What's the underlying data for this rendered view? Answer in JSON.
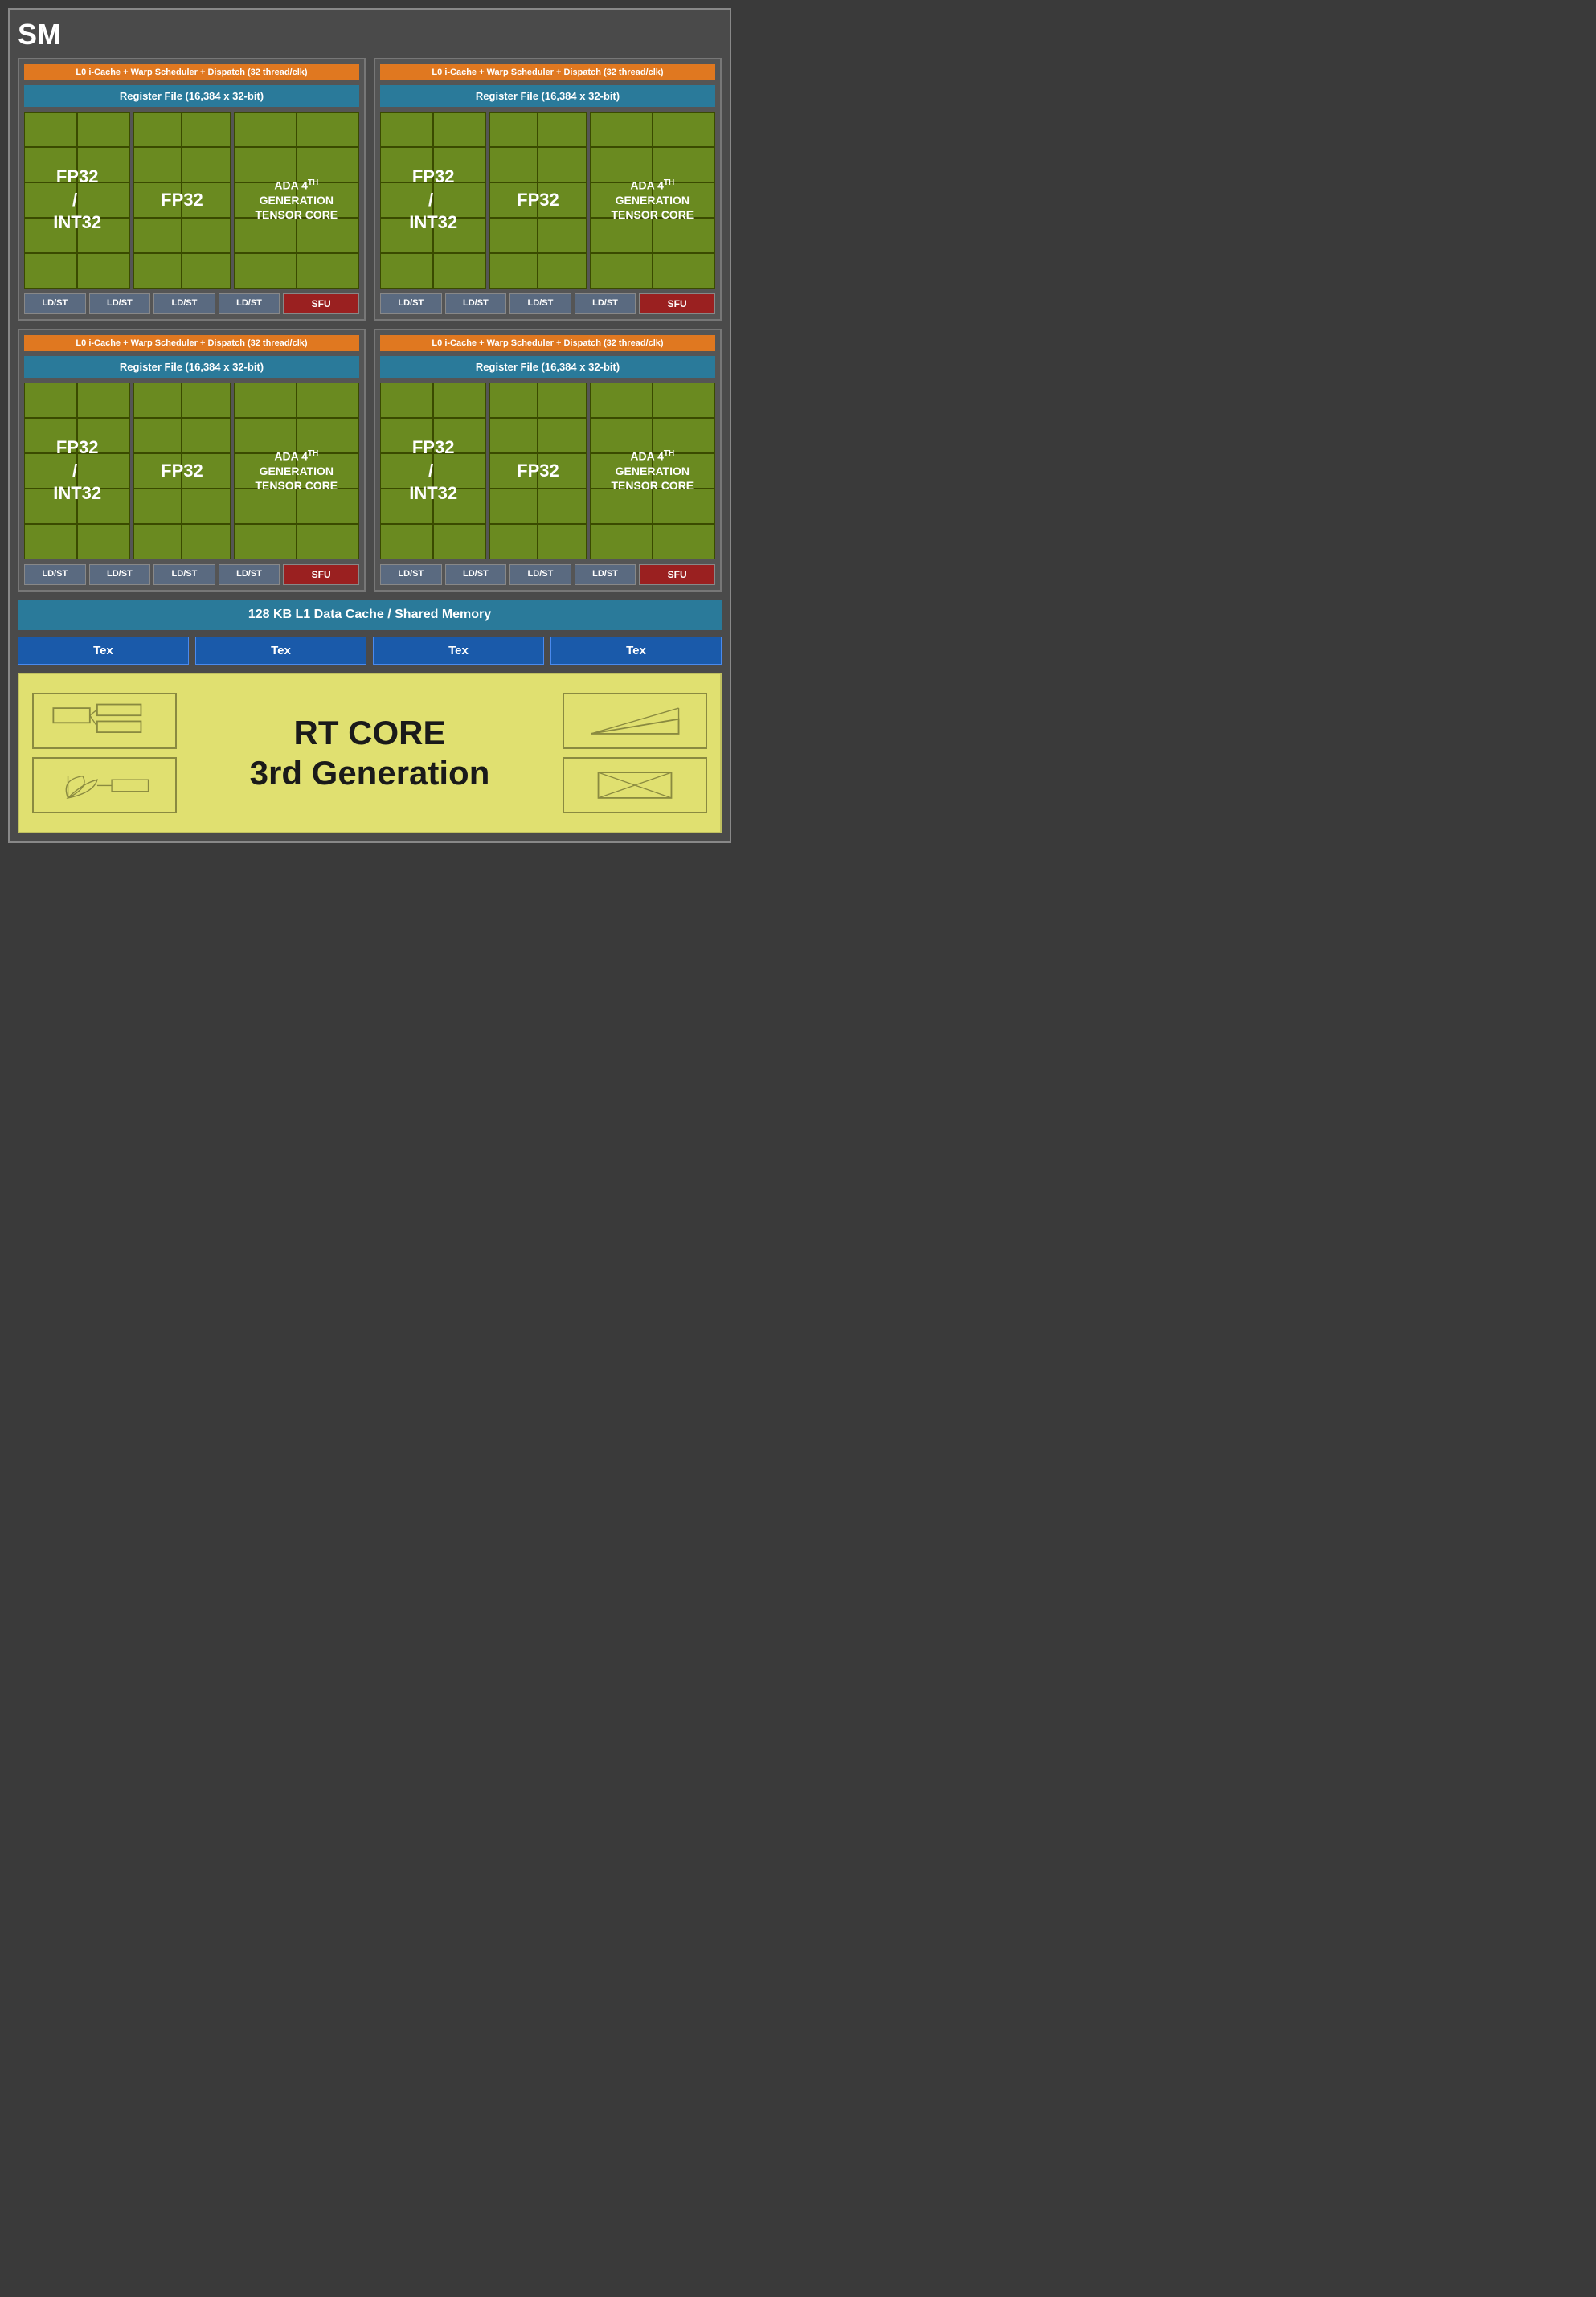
{
  "title": "SM",
  "quadrants": [
    {
      "l0_cache": "L0 i-Cache + Warp Scheduler + Dispatch (32 thread/clk)",
      "register_file": "Register File (16,384 x 32-bit)",
      "fp32_int32_label": "FP32\n/\nINT32",
      "fp32_label": "FP32",
      "tensor_label": "ADA 4th GENERATION TENSOR CORE",
      "ldst": [
        "LD/ST",
        "LD/ST",
        "LD/ST",
        "LD/ST"
      ],
      "sfu": "SFU"
    },
    {
      "l0_cache": "L0 i-Cache + Warp Scheduler + Dispatch (32 thread/clk)",
      "register_file": "Register File (16,384 x 32-bit)",
      "fp32_int32_label": "FP32\n/\nINT32",
      "fp32_label": "FP32",
      "tensor_label": "ADA 4th GENERATION TENSOR CORE",
      "ldst": [
        "LD/ST",
        "LD/ST",
        "LD/ST",
        "LD/ST"
      ],
      "sfu": "SFU"
    },
    {
      "l0_cache": "L0 i-Cache + Warp Scheduler + Dispatch (32 thread/clk)",
      "register_file": "Register File (16,384 x 32-bit)",
      "fp32_int32_label": "FP32\n/\nINT32",
      "fp32_label": "FP32",
      "tensor_label": "ADA 4th GENERATION TENSOR CORE",
      "ldst": [
        "LD/ST",
        "LD/ST",
        "LD/ST",
        "LD/ST"
      ],
      "sfu": "SFU"
    },
    {
      "l0_cache": "L0 i-Cache + Warp Scheduler + Dispatch (32 thread/clk)",
      "register_file": "Register File (16,384 x 32-bit)",
      "fp32_int32_label": "FP32\n/\nINT32",
      "fp32_label": "FP32",
      "tensor_label": "ADA 4th GENERATION TENSOR CORE",
      "ldst": [
        "LD/ST",
        "LD/ST",
        "LD/ST",
        "LD/ST"
      ],
      "sfu": "SFU"
    }
  ],
  "l1_cache": "128 KB L1 Data Cache / Shared Memory",
  "tex_units": [
    "Tex",
    "Tex",
    "Tex",
    "Tex"
  ],
  "rt_core": {
    "line1": "RT CORE",
    "line2": "3rd Generation"
  }
}
